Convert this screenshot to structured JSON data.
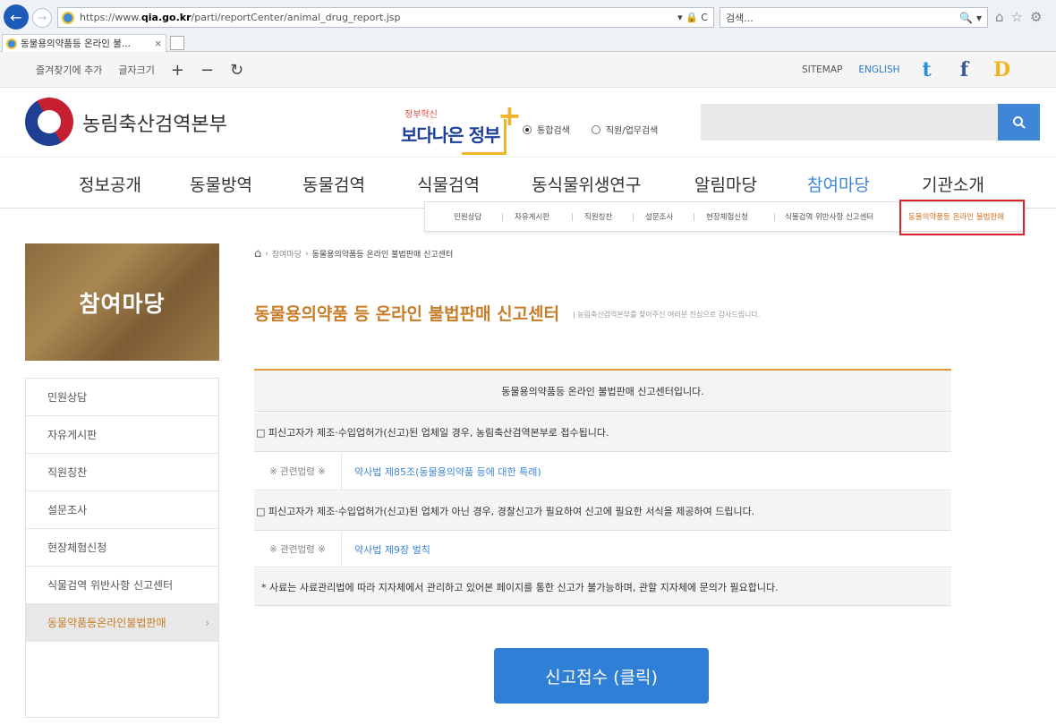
{
  "browser": {
    "url_prefix": "https://www.",
    "url_domain": "qia.go.kr",
    "url_path": "/parti/reportCenter/animal_drug_report.jsp",
    "url_tools": "▾ 🔒 C",
    "search_placeholder": "검색...",
    "search_icon": "🔍 ▾",
    "tab_title": "동물용의약품등 온라인 불...",
    "tab_close": "×",
    "chrome_icons": [
      "home-icon",
      "star-icon",
      "gear-icon"
    ],
    "chrome_glyphs": [
      "⌂",
      "☆",
      "⚙"
    ]
  },
  "util": {
    "favorite": "즐겨찾기에 추가",
    "fontsize": "글자크기",
    "plus": "+",
    "minus": "−",
    "reset": "↻",
    "sitemap": "SITEMAP",
    "english": "ENGLISH",
    "sns": [
      "t",
      "f",
      "D"
    ]
  },
  "header": {
    "logo_text": "농림축산검역본부",
    "badge_small": "정부혁신",
    "badge_main": "보다나은 정부",
    "badge_plus": "+",
    "radio_1": "통합검색",
    "radio_2": "직원/업무검색"
  },
  "gnb": [
    "정보공개",
    "동물방역",
    "동물검역",
    "식물검역",
    "동식물위생연구",
    "알림마당",
    "참여마당",
    "기관소개"
  ],
  "subnav": [
    "민원상담",
    "자유게시판",
    "직원칭찬",
    "설문조사",
    "현장체험신청",
    "식물검역 위반사항 신고센터",
    "동물의약품등 온라인 불법판매"
  ],
  "lnb": {
    "banner": "참여마당",
    "items": [
      "민원상담",
      "자유게시판",
      "직원칭찬",
      "설문조사",
      "현장체험신청",
      "식물검역 위반사항 신고센터",
      "동물약품등온라인불법판매"
    ],
    "chevron": "›"
  },
  "breadcrumb": {
    "sep1": "›",
    "parent": "참여마당",
    "sep2": "›",
    "current": "동물용의약품등 온라인 불법판매 신고센터"
  },
  "page": {
    "title": "동물용의약품 등 온라인 불법판매 신고센터",
    "desc": "| 농림축산검역본부를 찾아주신 여러분 진심으로 감사드립니다."
  },
  "board": {
    "heading": "동물용의약품등 온라인 불법판매 신고센터입니다.",
    "note1": "□ 피신고자가 제조·수입업허가(신고)된 업체일 경우, 농림축산검역본부로 접수됩니다.",
    "law1_label": "※ 관련법령 ※",
    "law1_value": "약사법 제85조(동물용의약품 등에 대한 특례)",
    "note2": "□ 피신고자가 제조·수입업허가(신고)된 업체가 아닌 경우, 경찰신고가 필요하여 신고에 필요한 서식을 제공하여 드립니다.",
    "law2_label": "※ 관련법령 ※",
    "law2_value": "약사법 제9장 벌칙",
    "note3": "* 사료는 사료관리법에 따라 지자체에서 관리하고 있어본 페이지를 통한 신고가 불가능하며, 관할 지자체에 문의가 필요합니다."
  },
  "report_button": "신고접수 (클릭)",
  "colors": {
    "accent_blue": "#3f86d8",
    "accent_orange": "#c77d28",
    "highlight_red": "#d7262e"
  }
}
